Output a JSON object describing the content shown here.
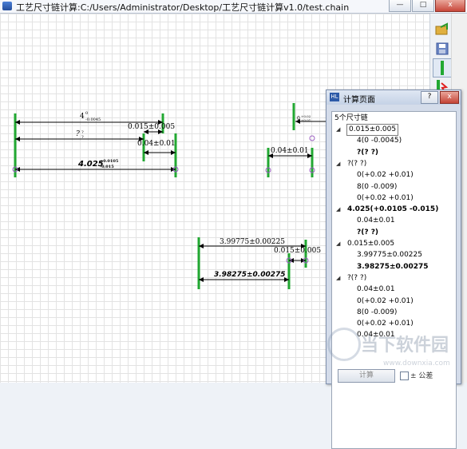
{
  "window": {
    "title": "工艺尺寸链计算:C:/Users/Administrator/Desktop/工艺尺寸链计算v1.0/test.chain",
    "buttons": {
      "minimize": "—",
      "maximize": "□",
      "close": "x"
    }
  },
  "drawing": {
    "chain1": {
      "top_dim_main": "4",
      "top_dim_upper": "0",
      "top_dim_lower": "-0.0045",
      "unknown_main": "?",
      "unknown_upper": "?",
      "unknown_lower": "?",
      "dim_015": "0.015±0.005",
      "dim_004": "0.04±0.01",
      "result_main": "4.025",
      "result_upper": "+0.0105",
      "result_lower": "-0.015"
    },
    "chain2": {
      "top_main": "0",
      "top_upper": "+0.02",
      "top_lower": "+0.01",
      "dim_004": "0.04±0.01"
    },
    "chain3": {
      "dim_top": "3.99775±0.00225",
      "dim_015": "0.015±0.005",
      "result": "3.98275±0.00275"
    }
  },
  "toolbar": {
    "icons": [
      "open-folder-icon",
      "save-icon",
      "green-bar-icon",
      "red-green-bar-icon"
    ]
  },
  "panel": {
    "title": "计算页面",
    "help_label": "?",
    "close_label": "x",
    "tree_header": "5个尺寸链",
    "rows": [
      {
        "text": "0.015±0.005",
        "level": 1,
        "bold": false,
        "twisty": "◢",
        "focus": true
      },
      {
        "text": "4(0 -0.0045)",
        "level": 2,
        "bold": false,
        "twisty": "",
        "focus": false
      },
      {
        "text": "?(? ?)",
        "level": 2,
        "bold": true,
        "twisty": "",
        "focus": false
      },
      {
        "text": "?(? ?)",
        "level": 1,
        "bold": false,
        "twisty": "◢",
        "focus": false
      },
      {
        "text": "0(+0.02 +0.01)",
        "level": 2,
        "bold": false,
        "twisty": "",
        "focus": false
      },
      {
        "text": "8(0 -0.009)",
        "level": 2,
        "bold": false,
        "twisty": "",
        "focus": false
      },
      {
        "text": "0(+0.02 +0.01)",
        "level": 2,
        "bold": false,
        "twisty": "",
        "focus": false
      },
      {
        "text": "4.025(+0.0105 -0.015)",
        "level": 1,
        "bold": true,
        "twisty": "◢",
        "focus": false
      },
      {
        "text": "0.04±0.01",
        "level": 2,
        "bold": false,
        "twisty": "",
        "focus": false
      },
      {
        "text": "?(? ?)",
        "level": 2,
        "bold": true,
        "twisty": "",
        "focus": false
      },
      {
        "text": "0.015±0.005",
        "level": 1,
        "bold": false,
        "twisty": "◢",
        "focus": false
      },
      {
        "text": "3.99775±0.00225",
        "level": 2,
        "bold": false,
        "twisty": "",
        "focus": false
      },
      {
        "text": "3.98275±0.00275",
        "level": 2,
        "bold": true,
        "twisty": "",
        "focus": false
      },
      {
        "text": "?(? ?)",
        "level": 1,
        "bold": false,
        "twisty": "◢",
        "focus": false
      },
      {
        "text": "0.04±0.01",
        "level": 2,
        "bold": false,
        "twisty": "",
        "focus": false
      },
      {
        "text": "0(+0.02 +0.01)",
        "level": 2,
        "bold": false,
        "twisty": "",
        "focus": false
      },
      {
        "text": "8(0 -0.009)",
        "level": 2,
        "bold": false,
        "twisty": "",
        "focus": false
      },
      {
        "text": "0(+0.02 +0.01)",
        "level": 2,
        "bold": false,
        "twisty": "",
        "focus": false
      },
      {
        "text": "0.04±0.01",
        "level": 2,
        "bold": false,
        "twisty": "",
        "focus": false
      }
    ],
    "calc_button": "计算",
    "tolerance_label": "± 公差"
  },
  "watermark": {
    "text": "当下软件园",
    "url": "www.downxia.com"
  },
  "colors": {
    "accent_green": "#22a832",
    "accent_red": "#e02020",
    "dim_line": "#000000",
    "point_marker": "#9b5fc0"
  }
}
